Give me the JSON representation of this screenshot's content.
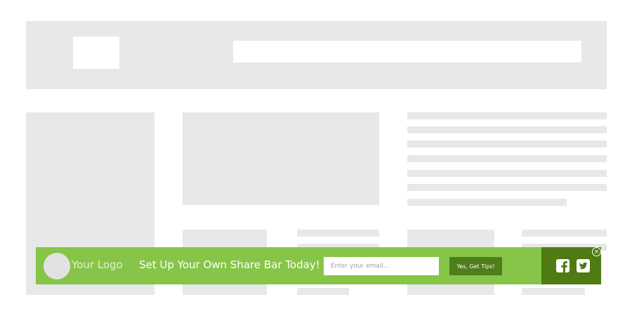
{
  "share_bar": {
    "logo_text": "Your Logo",
    "headline": "Set Up Your Own Share Bar Today!",
    "email_placeholder": "Enter your email...",
    "cta_label": "Yes, Get Tips!",
    "close_symbol": "×",
    "social_icons": [
      "facebook-icon",
      "twitter-icon"
    ],
    "colors": {
      "bar": "#86c547",
      "cta_button": "#4f7d1b",
      "social_panel": "#4e7b12"
    }
  },
  "wireframe": {
    "placeholder_color": "#e7e8e9"
  }
}
